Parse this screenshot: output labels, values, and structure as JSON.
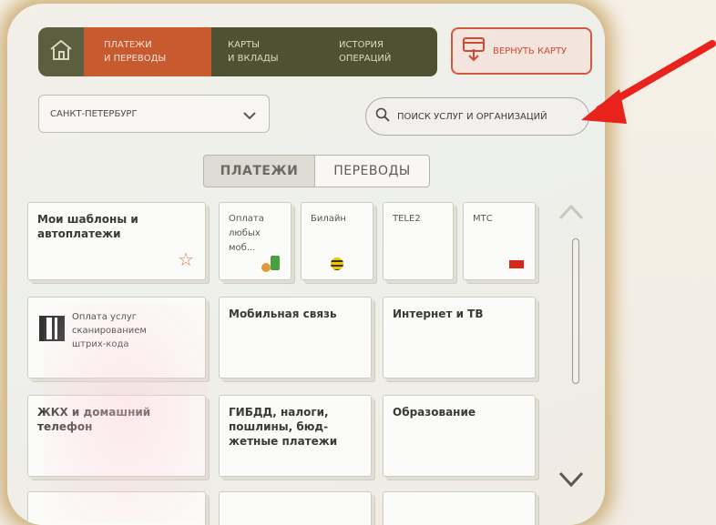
{
  "nav": {
    "pay_line1": "ПЛАТЕЖИ",
    "pay_line2": "И ПЕРЕВОДЫ",
    "cards_line1": "КАРТЫ",
    "cards_line2": "И ВКЛАДЫ",
    "history_line1": "ИСТОРИЯ",
    "history_line2": "ОПЕРАЦИЙ",
    "return_card": "ВЕРНУТЬ КАРТУ"
  },
  "city": {
    "value": "САНКТ-ПЕТЕРБУРГ"
  },
  "search": {
    "placeholder": "ПОИСК УСЛУГ И ОРГАНИЗАЦИЙ"
  },
  "segment": {
    "active": "ПЛАТЕЖИ",
    "inactive": "ПЕРЕВОДЫ"
  },
  "tiles": {
    "templates": "Мои шаблоны и\nавтоплатежи",
    "pay_any": "Оплата\nлюбых\nмоб...",
    "beeline": "Билайн",
    "tele2": "TELE2",
    "mts": "МТС",
    "qr": "Оплата услуг\nсканированием\nштрих-кода",
    "mobile": "Мобильная связь",
    "internet": "Интернет и ТВ",
    "housing": "ЖКХ и домашний\nтелефон",
    "gibdd": "ГИБДД, налоги,\nпошлины, бюд-\nжетные платежи",
    "education": "Образование"
  },
  "colors": {
    "accent": "#c75a2e",
    "nav_dark": "#4e5132",
    "arrow": "#e8231c"
  }
}
